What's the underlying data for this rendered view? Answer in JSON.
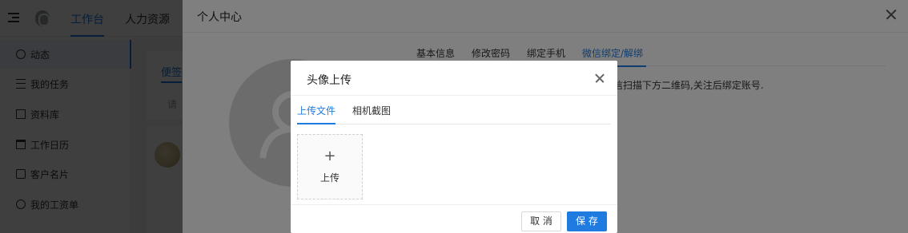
{
  "topbar": {
    "tabs": [
      {
        "label": "工作台",
        "active": true
      },
      {
        "label": "人力资源",
        "active": false
      }
    ]
  },
  "sidebar": {
    "items": [
      {
        "label": "动态",
        "icon": "clock-icon",
        "active": true
      },
      {
        "label": "我的任务",
        "icon": "list-icon",
        "active": false
      },
      {
        "label": "资料库",
        "icon": "book-icon",
        "active": false
      },
      {
        "label": "工作日历",
        "icon": "calendar-icon",
        "active": false
      },
      {
        "label": "客户名片",
        "icon": "card-icon",
        "active": false
      },
      {
        "label": "我的工资单",
        "icon": "coin-icon",
        "active": false
      }
    ]
  },
  "content": {
    "note_tab": "便签",
    "note_hint": "请"
  },
  "drawer": {
    "title": "个人中心",
    "tabs": [
      {
        "label": "基本信息",
        "active": false
      },
      {
        "label": "修改密码",
        "active": false
      },
      {
        "label": "绑定手机",
        "active": false
      },
      {
        "label": "微信绑定/解绑",
        "active": true
      }
    ],
    "wechat_tip": "信扫描下方二维码,关注后绑定账号."
  },
  "modal": {
    "title": "头像上传",
    "tabs": [
      {
        "label": "上传文件",
        "active": true
      },
      {
        "label": "相机截图",
        "active": false
      }
    ],
    "upload_plus": "+",
    "upload_label": "上传",
    "cancel_label": "取 消",
    "save_label": "保 存"
  },
  "colors": {
    "accent": "#1f7be0",
    "mask": "rgba(0,0,0,0.5)"
  }
}
